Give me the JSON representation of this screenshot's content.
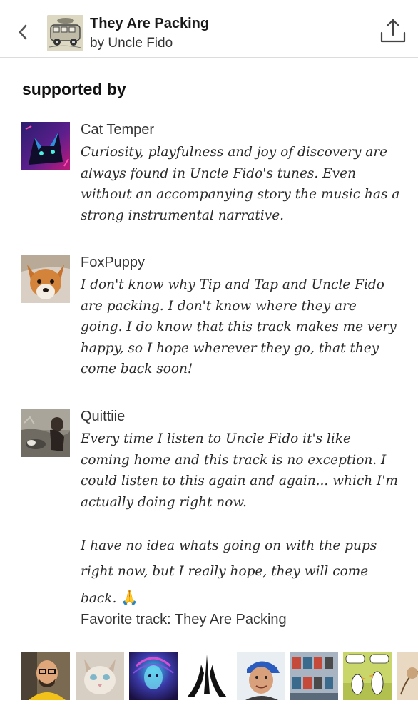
{
  "header": {
    "album_title": "They Are Packing",
    "artist_line": "by Uncle Fido",
    "back_icon": "chevron-left-icon",
    "share_icon": "share-icon"
  },
  "section": {
    "title": "supported by"
  },
  "supporters": [
    {
      "name": "Cat Temper",
      "quote": "Curiosity, playfulness and joy of discovery are always found in Uncle Fido's tunes. Even without an accompanying story the music has a strong instrumental narrative."
    },
    {
      "name": "FoxPuppy",
      "quote": "I don't know why Tip and Tap and Uncle Fido are packing.  I don't know where they are going.  I do know that this track makes me very happy, so I hope wherever they go, that they come back soon!"
    },
    {
      "name": "Quittiie",
      "quote_part1": "Every time I listen to Uncle Fido it's like coming home and this track is no exception. I could listen to this again and again... which I'm actually doing right now.",
      "quote_part2": "I have no idea whats going on with the pups right now, but I really hope, they will come back.",
      "emoji": "🙏",
      "favorite_label": "Favorite track:",
      "favorite_track": "They Are Packing"
    }
  ],
  "more_supporters_icons": [
    "supporter-avatar-man-glasses",
    "supporter-avatar-cat",
    "supporter-avatar-psychedelic-face",
    "supporter-avatar-spires-logo",
    "supporter-avatar-man-cap",
    "supporter-avatar-robots",
    "supporter-avatar-birds-comic",
    "supporter-avatar-sketch"
  ]
}
